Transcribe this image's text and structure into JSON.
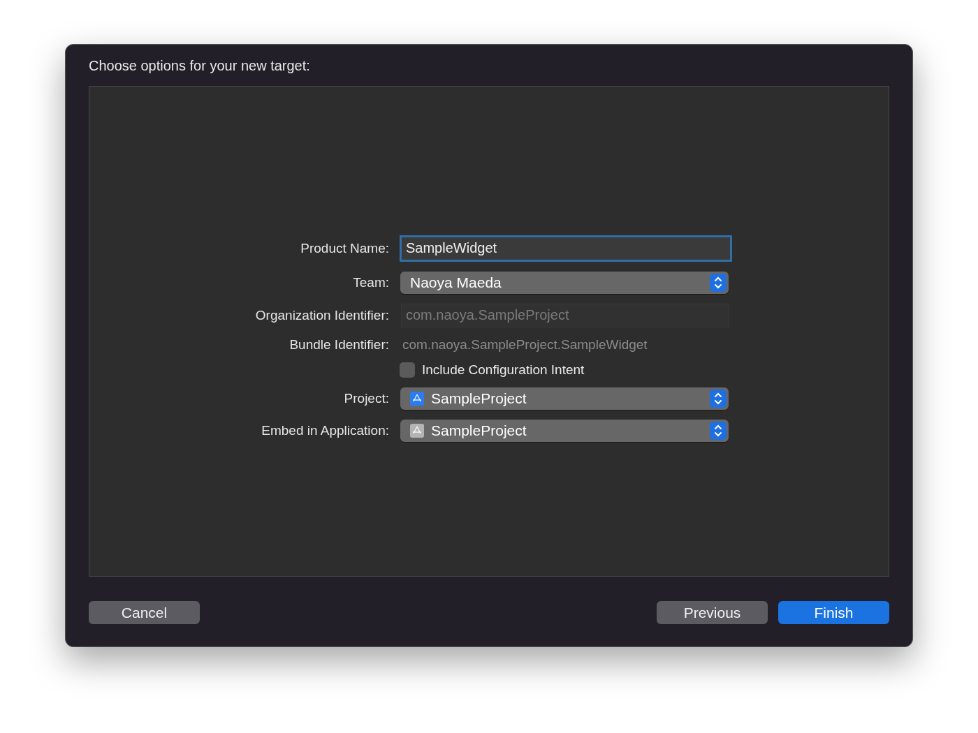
{
  "window": {
    "title": "Choose options for your new target:"
  },
  "form": [
    {
      "kind": "text",
      "label": "Product Name:",
      "value": "SampleWidget",
      "focused": true
    },
    {
      "kind": "popup",
      "label": "Team:",
      "value": "Naoya Maeda"
    },
    {
      "kind": "disabled-text",
      "label": "Organization Identifier:",
      "value": "com.naoya.SampleProject"
    },
    {
      "kind": "static",
      "label": "Bundle Identifier:",
      "value": "com.naoya.SampleProject.SampleWidget"
    },
    {
      "kind": "checkbox",
      "label": "Include Configuration Intent",
      "checked": false
    },
    {
      "kind": "icon-popup",
      "label": "Project:",
      "value": "SampleProject",
      "color": "#2b7cf0"
    },
    {
      "kind": "icon-popup",
      "label": "Embed in Application:",
      "value": "SampleProject",
      "color": "#b4b4b4"
    }
  ],
  "buttons": [
    {
      "label": "Cancel",
      "kind": "normal"
    },
    {
      "label": "Previous",
      "kind": "normal"
    },
    {
      "label": "Finish",
      "kind": "default"
    }
  ]
}
